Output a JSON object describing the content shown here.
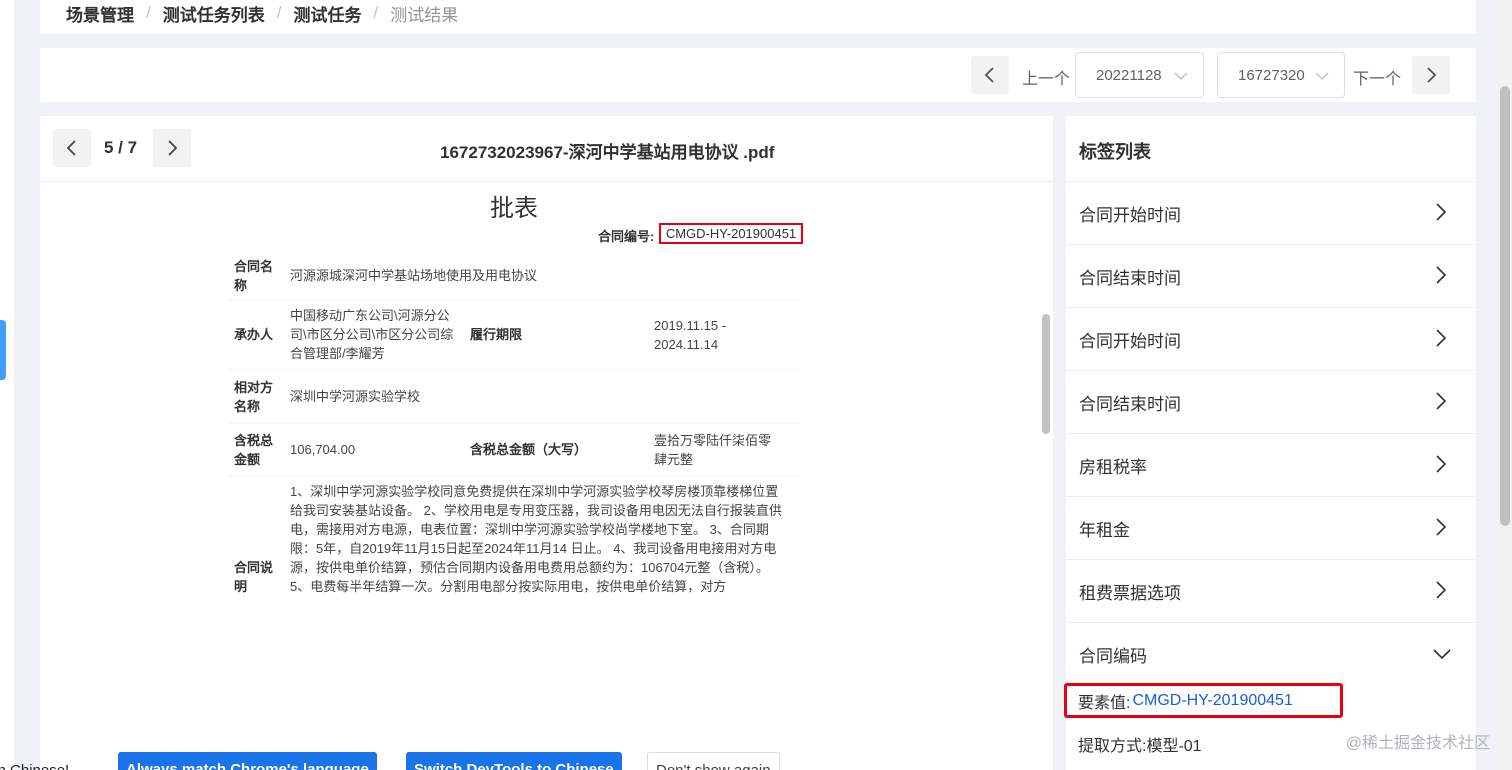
{
  "breadcrumb": [
    "场景管理",
    "测试任务列表",
    "测试任务",
    "测试结果"
  ],
  "breadcrumb_sep": "/",
  "toolbar": {
    "prev_label": "上一个",
    "next_label": "下一个",
    "date_select": "20221128",
    "id_select": "16727320"
  },
  "viewer": {
    "page_counter": "5 / 7",
    "doc_title": "1672732023967-深河中学基站用电协议 .pdf",
    "pdf": {
      "title": "批表",
      "contract_no_label": "合同编号:",
      "contract_no_value": "CMGD-HY-201900451",
      "rows": {
        "name_label": "合同名称",
        "name_value": "河源源城深河中学基站场地使用及用电协议",
        "handler_label": "承办人",
        "handler_value": "中国移动广东公司\\河源分公司\\市区分公司\\市区分公司综合管理部/李耀芳",
        "period_label": "履行期限",
        "period_value": "2019.11.15 - 2024.11.14",
        "party_label": "相对方名称",
        "party_value": "深圳中学河源实验学校",
        "amount_label": "含税总金额",
        "amount_value": "106,704.00",
        "amount_cn_label": "含税总金额（大写）",
        "amount_cn_value": "壹拾万零陆仟柒佰零肆元整",
        "desc_label": "合同说明",
        "desc_value": "1、深圳中学河源实验学校同意免费提供在深圳中学河源实验学校琴房楼顶靠楼梯位置给我司安装基站设备。 2、学校用电是专用变压器，我司设备用电因无法自行报装直供电，需接用对方电源，电表位置：深圳中学河源实验学校尚学楼地下室。 3、合同期限：5年，自2019年11月15日起至2024年11月14 日止。 4、我司设备用电接用对方电源，按供电单价结算，预估合同期内设备用电费用总额约为：106704元整（含税）。 5、电费每半年结算一次。分割用电部分按实际用电，按供电单价结算，对方"
      }
    }
  },
  "labels": {
    "header": "标签列表",
    "items": [
      "合同开始时间",
      "合同结束时间",
      "合同开始时间",
      "合同结束时间",
      "房租税率",
      "年租金",
      "租费票据选项",
      "合同编码"
    ],
    "value_label": "要素值:",
    "value": "CMGD-HY-201900451",
    "method": "提取方式:模型-01"
  },
  "watermark": "@稀土掘金技术社区",
  "lang_bar": {
    "text": "ble in Chinese!",
    "btn1": "Always match Chrome's language",
    "btn2": "Switch DevTools to Chinese",
    "btn3": "Don't show again"
  },
  "colors": {
    "highlight": "#e60012",
    "accent": "#1a73e8",
    "link": "#1a5fd6"
  }
}
